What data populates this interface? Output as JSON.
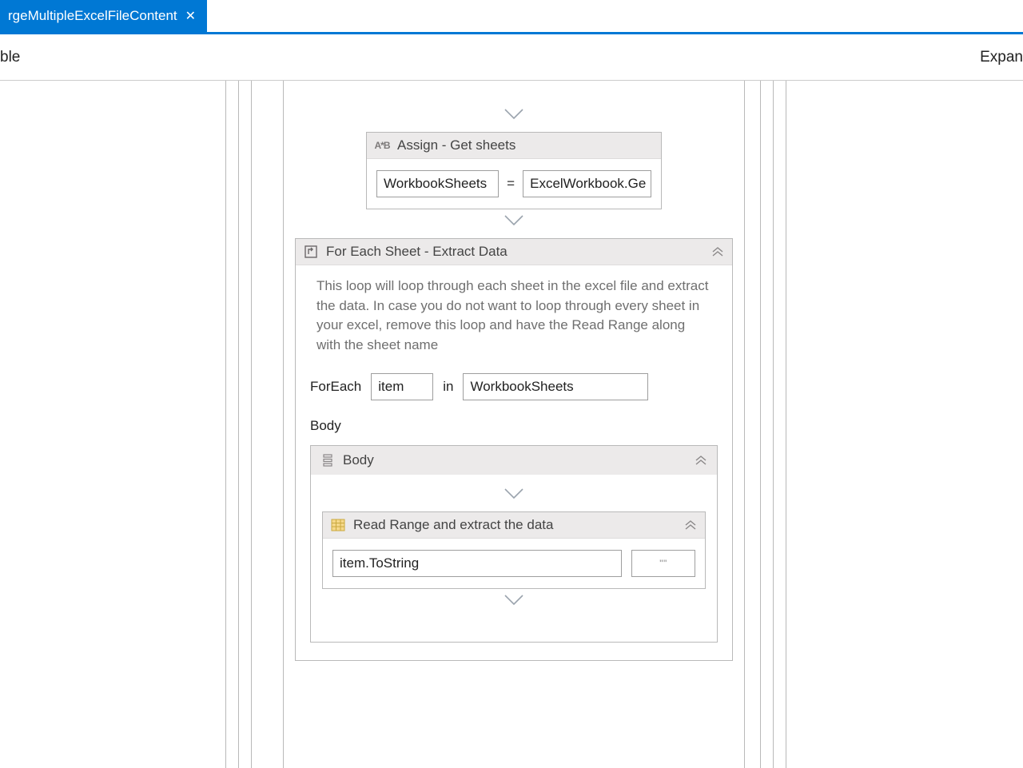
{
  "tab": {
    "title": "rgeMultipleExcelFileContent"
  },
  "header": {
    "left": "ble",
    "right": "Expan"
  },
  "assign": {
    "title": "Assign - Get sheets",
    "to": "WorkbookSheets",
    "equals": "=",
    "value": "ExcelWorkbook.Ge"
  },
  "foreach": {
    "title": "For Each Sheet - Extract Data",
    "description": "This loop will loop through each sheet in the excel file and extract the data. In case you do not want to loop through every sheet in your excel, remove this loop and have the Read Range along with the sheet name",
    "foreach_label": "ForEach",
    "item": "item",
    "in_label": "in",
    "collection": "WorkbookSheets",
    "body_label": "Body",
    "body_seq_title": "Body",
    "readrange": {
      "title": "Read Range and extract the data",
      "sheet": "item.ToString",
      "range": "\"\""
    }
  }
}
